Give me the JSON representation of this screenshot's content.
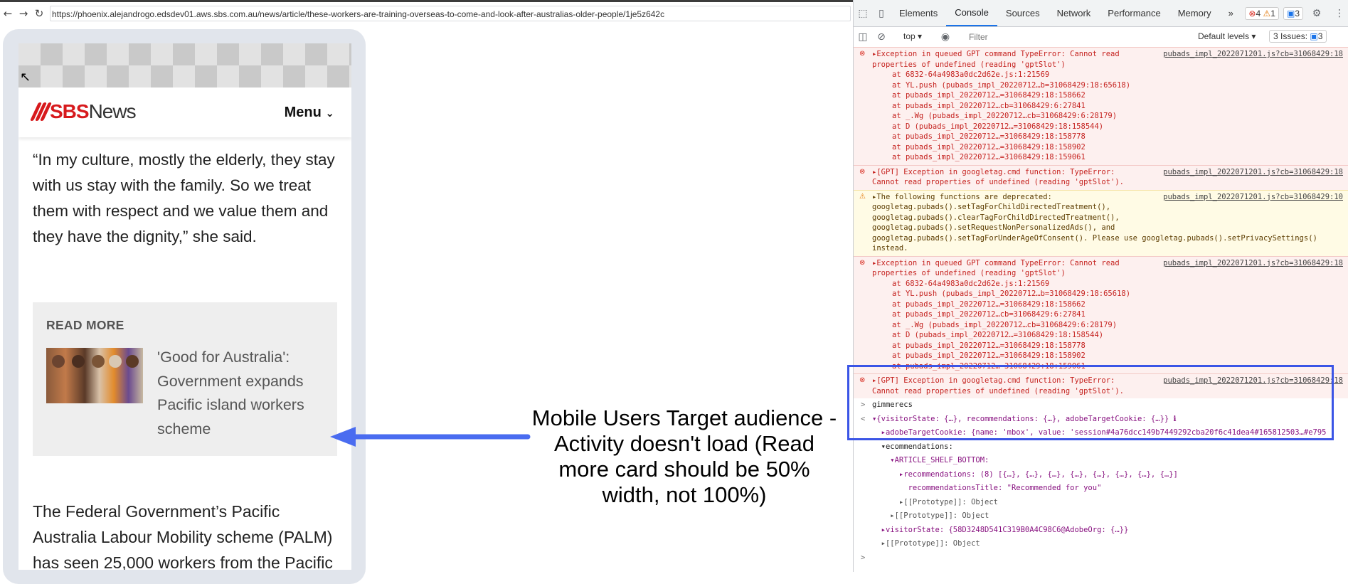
{
  "browser": {
    "url": "https://phoenix.alejandrogo.edsdev01.aws.sbs.com.au/news/article/these-workers-are-training-overseas-to-come-and-look-after-australias-older-people/1je5z642c"
  },
  "site": {
    "logo_sbs": "SBS",
    "logo_news": "News",
    "menu_label": "Menu"
  },
  "article": {
    "quote": "“In my culture, mostly the elderly, they stay with us stay with the family. So we treat them with respect and we value them and they have the dignity,” she said.",
    "read_more": {
      "label": "READ MORE",
      "title": "'Good for Australia': Government expands Pacific island workers scheme"
    },
    "paragraph": "The Federal Government’s Pacific Australia Labour Mobility scheme (PALM) has seen 25,000 workers from the Pacific"
  },
  "annotation": {
    "text": "Mobile Users Target audience - Activity doesn't load (Read more card should be 50% width, not 100%)",
    "arrow_color": "#4a6cf0"
  },
  "devtools": {
    "tabs": [
      "Elements",
      "Console",
      "Sources",
      "Network",
      "Performance",
      "Memory"
    ],
    "active_tab": "Console",
    "more_tabs": "»",
    "error_count": "4",
    "warning_count": "1",
    "message_count": "3",
    "context": "top",
    "filter_placeholder": "Filter",
    "levels": "Default levels",
    "issues": "3 Issues:",
    "issues_count": "3",
    "messages": [
      {
        "type": "error",
        "source": "pubads_impl_2022071201.js?cb=31068429:18",
        "lines": [
          "▸Exception in queued GPT command TypeError: Cannot read",
          "properties of undefined (reading 'gptSlot')"
        ],
        "stack": [
          "at 6832-64a4983a0dc2d62e.js:1:21569",
          "at YL.push (pubads_impl_20220712…b=31068429:18:65618)",
          "at pubads_impl_20220712…=31068429:18:158662",
          "at pubads_impl_20220712…cb=31068429:6:27841",
          "at _.Wg (pubads_impl_20220712…cb=31068429:6:28179)",
          "at D (pubads_impl_20220712…=31068429:18:158544)",
          "at pubads_impl_20220712…=31068429:18:158778",
          "at pubads_impl_20220712…=31068429:18:158902",
          "at pubads_impl_20220712…=31068429:18:159061"
        ]
      },
      {
        "type": "error",
        "source": "pubads_impl_2022071201.js?cb=31068429:18",
        "lines": [
          "▸[GPT] Exception in googletag.cmd function: TypeError:",
          "Cannot read properties of undefined (reading 'gptSlot')."
        ],
        "stack": []
      },
      {
        "type": "warning",
        "source": "pubads_impl_2022071201.js?cb=31068429:10",
        "lines": [
          "▸The following functions are deprecated:",
          "googletag.pubads().setTagForChildDirectedTreatment(),",
          "googletag.pubads().clearTagForChildDirectedTreatment(),",
          "googletag.pubads().setRequestNonPersonalizedAds(), and",
          "googletag.pubads().setTagForUnderAgeOfConsent(). Please use googletag.pubads().setPrivacySettings()",
          "instead."
        ],
        "stack": []
      },
      {
        "type": "error",
        "source": "pubads_impl_2022071201.js?cb=31068429:18",
        "lines": [
          "▸Exception in queued GPT command TypeError: Cannot read",
          "properties of undefined (reading 'gptSlot')"
        ],
        "stack": [
          "at 6832-64a4983a0dc2d62e.js:1:21569",
          "at YL.push (pubads_impl_20220712…b=31068429:18:65618)",
          "at pubads_impl_20220712…=31068429:18:158662",
          "at pubads_impl_20220712…cb=31068429:6:27841",
          "at _.Wg (pubads_impl_20220712…cb=31068429:6:28179)",
          "at D (pubads_impl_20220712…=31068429:18:158544)",
          "at pubads_impl_20220712…=31068429:18:158778",
          "at pubads_impl_20220712…=31068429:18:158902",
          "at pubads_impl_20220712…=31068429:18:159061"
        ]
      },
      {
        "type": "error",
        "source": "pubads_impl_2022071201.js?cb=31068429:18",
        "lines": [
          "▸[GPT] Exception in googletag.cmd function: TypeError:",
          "Cannot read properties of undefined (reading 'gptSlot')."
        ],
        "stack": []
      }
    ],
    "console_tail": [
      {
        "prefix": ">",
        "text": "gimmerecs"
      },
      {
        "prefix": "<",
        "text": "▾{visitorState: {…}, recommendations: {…}, adobeTargetCookie: {…}} ℹ"
      },
      {
        "prefix": "",
        "text": "  ▸adobeTargetCookie: {name: 'mbox', value: 'session#4a76dcc149b7449292cba20f6c41dea4#165812503…#e795"
      },
      {
        "prefix": "",
        "text": "  ▾ecommendations:"
      },
      {
        "prefix": "",
        "text": "    ▾ARTICLE_SHELF_BOTTOM:"
      },
      {
        "prefix": "",
        "text": "      ▸recommendations: (8) [{…}, {…}, {…}, {…}, {…}, {…}, {…}, {…}]"
      },
      {
        "prefix": "",
        "text": "        recommendationsTitle: \"Recommended for you\""
      },
      {
        "prefix": "",
        "text": "      ▸[[Prototype]]: Object"
      },
      {
        "prefix": "",
        "text": "    ▸[[Prototype]]: Object"
      },
      {
        "prefix": "",
        "text": "  ▸visitorState: {58D3248D541C319B0A4C98C6@AdobeOrg: {…}}"
      },
      {
        "prefix": "",
        "text": "  ▸[[Prototype]]: Object"
      },
      {
        "prefix": ">",
        "text": ""
      }
    ]
  },
  "colors": {
    "sbs_red": "#d7191c",
    "highlight_blue": "#3b55e6",
    "error_bg": "#fdf0ef",
    "warning_bg": "#fffbe5"
  }
}
